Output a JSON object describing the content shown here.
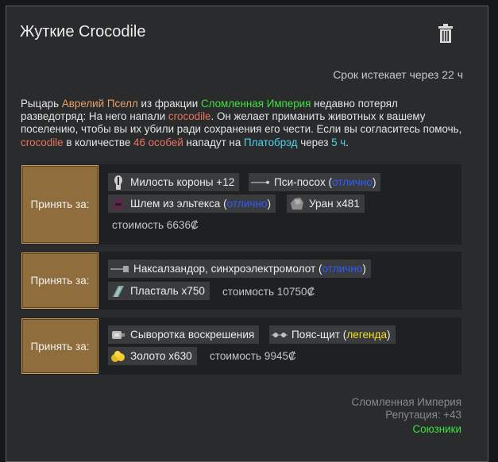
{
  "quest": {
    "title": "Жуткие Crocodile",
    "expires": "Срок истекает через 22 ч",
    "desc": {
      "p1": "Рыцарь ",
      "knight": "Аврелий Пселл",
      "p2": " из фракции ",
      "faction": "Сломленная Империя",
      "p3": " недавно потерял разведотряд: На него напали ",
      "animal1": "crocodile",
      "p4": ". Он желает приманить животных к вашему поселению, чтобы вы их убили ради сохранения его чести. Если вы согласитесь помочь, ",
      "animal2": "crocodile",
      "p5": " в количестве ",
      "count": "46 особей",
      "p6": " нападут на ",
      "settlement": "Платобрэд",
      "p7": " через ",
      "time": "5 ч",
      "p8": "."
    }
  },
  "offers": [
    {
      "accept_label": "Принять за:",
      "items": [
        {
          "name": "Милость короны +12",
          "icon": "crown-favor-icon"
        },
        {
          "name": "Пси-посох (",
          "quality": "отлично",
          "suffix": ")",
          "icon": "psi-staff-icon"
        },
        {
          "name": "Шлем из эльтекса (",
          "quality": "отлично",
          "suffix": ")",
          "icon": "eltex-helmet-icon"
        },
        {
          "name": "Уран x481",
          "icon": "uranium-icon"
        }
      ],
      "cost": "стоимость 6636₡"
    },
    {
      "accept_label": "Принять за:",
      "items": [
        {
          "name": "Наксалзандор, синхроэлектромолот (",
          "quality": "отлично",
          "suffix": ")",
          "icon": "hammer-icon"
        },
        {
          "name": "Пласталь x750",
          "icon": "plasteel-icon"
        }
      ],
      "cost": "стоимость 10750₡"
    },
    {
      "accept_label": "Принять за:",
      "items": [
        {
          "name": "Сыворотка воскрешения",
          "icon": "resurrection-serum-icon"
        },
        {
          "name": "Пояс-щит (",
          "quality": "легенда",
          "suffix": ")",
          "icon": "shield-belt-icon"
        },
        {
          "name": "Золото x630",
          "icon": "gold-icon"
        }
      ],
      "cost": "стоимость 9945₡"
    }
  ],
  "footer": {
    "faction": "Сломленная Империя",
    "reputation": "Репутация: +43",
    "relation": "Союзники"
  },
  "colors": {
    "accent_orange": "#e6a06a",
    "faction_green": "#3fe23f",
    "animal_red": "#e8735e",
    "settlement_cyan": "#4fd3ee",
    "quality_excellent": "#2f5cff",
    "quality_legendary": "#f0e020",
    "accept_button": "#8f6d3c"
  }
}
